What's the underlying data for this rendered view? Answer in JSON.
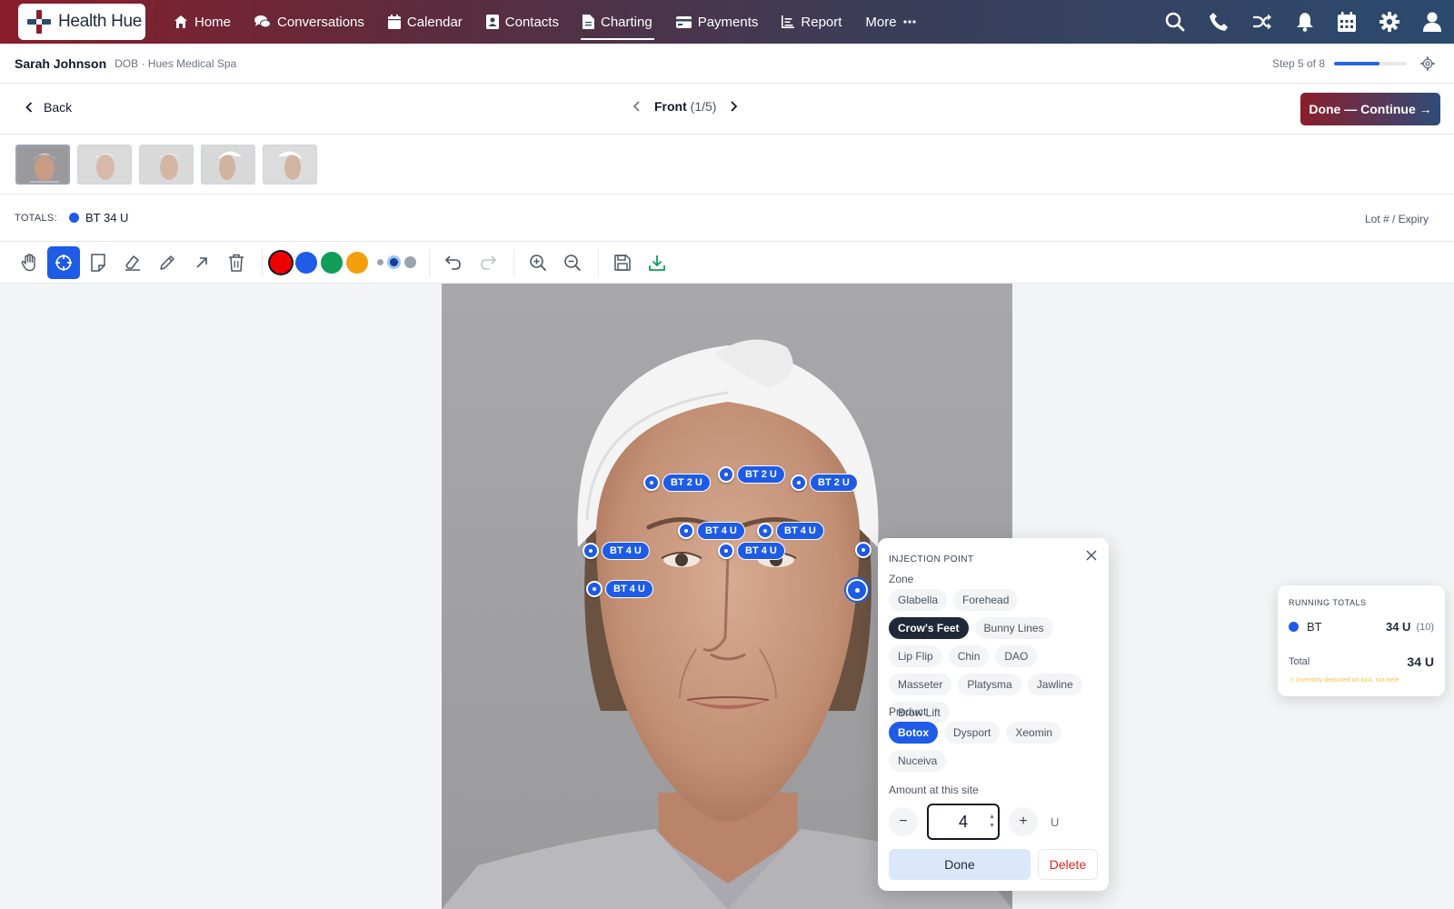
{
  "app": {
    "name": "Health Hue"
  },
  "nav": {
    "items": [
      {
        "label": "Home",
        "icon": "home-icon"
      },
      {
        "label": "Conversations",
        "icon": "chat-icon"
      },
      {
        "label": "Calendar",
        "icon": "calendar-icon"
      },
      {
        "label": "Contacts",
        "icon": "contact-icon"
      },
      {
        "label": "Charting",
        "icon": "document-icon",
        "active": true
      },
      {
        "label": "Payments",
        "icon": "card-icon"
      },
      {
        "label": "Report",
        "icon": "chart-icon"
      },
      {
        "label": "More",
        "icon": "ellipsis-icon"
      }
    ],
    "right_icons": [
      "search-icon",
      "phone-icon",
      "shuffle-icon",
      "bell-icon",
      "calendar-icon",
      "gear-icon",
      "user-icon"
    ]
  },
  "patient": {
    "name": "Sarah Johnson",
    "meta": "DOB · Hues Medical Spa",
    "step": "Step 5 of 8",
    "step_progress": 0.625
  },
  "header": {
    "back_label": "Back",
    "view_name": "Front",
    "view_count": "(1/5)",
    "continue_label": "Done — Continue →"
  },
  "thumbnails": {
    "count": 5,
    "active_index": 0
  },
  "totals": {
    "label": "TOTALS:",
    "value": "BT 34 U",
    "lot_label": "Lot # / Expiry"
  },
  "toolbar": {
    "tools": [
      "hand-icon",
      "crosshair-icon",
      "note-icon",
      "eraser-icon",
      "pencil-icon",
      "arrow-icon",
      "trash-icon"
    ],
    "active_tool": "crosshair-icon",
    "colors": [
      "#ef0000",
      "#1e5be6",
      "#0f9d58",
      "#f59e0b"
    ],
    "selected_color": "#ef0000"
  },
  "injection_points": [
    {
      "label": "BT 2 U"
    },
    {
      "label": "BT 2 U"
    },
    {
      "label": "BT 2 U"
    },
    {
      "label": "BT 4 U"
    },
    {
      "label": "BT 4 U"
    },
    {
      "label": "BT 4 U"
    },
    {
      "label": "BT 4 U"
    },
    {
      "label": "BT 4 U"
    }
  ],
  "popover": {
    "title": "INJECTION POINT",
    "zone_label": "Zone",
    "zones": [
      "Glabella",
      "Forehead",
      "Crow's Feet",
      "Bunny Lines",
      "Lip Flip",
      "Chin",
      "DAO",
      "Masseter",
      "Platysma",
      "Jawline",
      "Brow Lift"
    ],
    "selected_zone": "Crow's Feet",
    "product_label": "Product",
    "products": [
      "Botox",
      "Dysport",
      "Xeomin",
      "Nuceiva"
    ],
    "selected_product": "Botox",
    "amount_label": "Amount at this site",
    "amount": "4",
    "unit": "U",
    "minus": "−",
    "plus": "+",
    "done_label": "Done",
    "delete_label": "Delete"
  },
  "running_totals": {
    "title": "RUNNING TOTALS",
    "product": "BT",
    "amount": "34 U",
    "sites": "(10)",
    "total_label": "Total",
    "total_value": "34 U",
    "note": "Inventory deducted on lock, not here"
  },
  "colors": {
    "accent": "#1e5be6",
    "danger": "#dc2626",
    "brand_start": "#8a1e2c",
    "brand_end": "#2c4a6e"
  }
}
